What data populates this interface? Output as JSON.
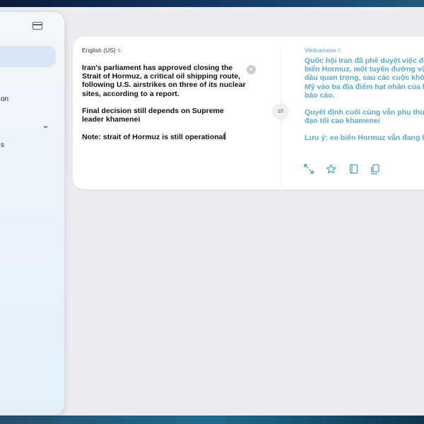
{
  "sidebar": {
    "items": [
      {
        "label": "on"
      },
      {
        "label": "s"
      }
    ]
  },
  "source": {
    "language": "English (US)",
    "paragraphs": [
      "Iran's parliament has approved closing the Strait of Hormuz, a critical oil shipping route, following U.S. airstrikes on three of its nuclear sites, according to a report.",
      "Final decision still depends on Supreme leader khamenei",
      "Note: strait of Hormuz is still operational"
    ]
  },
  "target": {
    "language": "Vietnamese",
    "paragraphs": [
      "Quốc hội Iran đã phê duyệt việc đó",
      "biển Hormuz, một tuyến đường vậ",
      "dầu quan trọng, sau các cuộc khôn",
      "Mỹ vào ba địa điểm hạt nhân của h",
      "báo cáo.",
      "Quyết định cuối cùng vẫn phụ thuộ",
      "đạo tối cao khamenei",
      "Lưu ý: eo biển Hormuz vẫn đang ho"
    ]
  },
  "icons": {
    "sidebar_toggle": "sidebar-toggle-icon",
    "chevron": "chevron-down-icon",
    "clear": "clear-icon",
    "swap": "swap-icon",
    "expand": "expand-icon",
    "favorite": "star-icon",
    "dictionary": "book-icon",
    "copy": "copy-icon"
  },
  "colors": {
    "accent": "#58a8c8"
  }
}
